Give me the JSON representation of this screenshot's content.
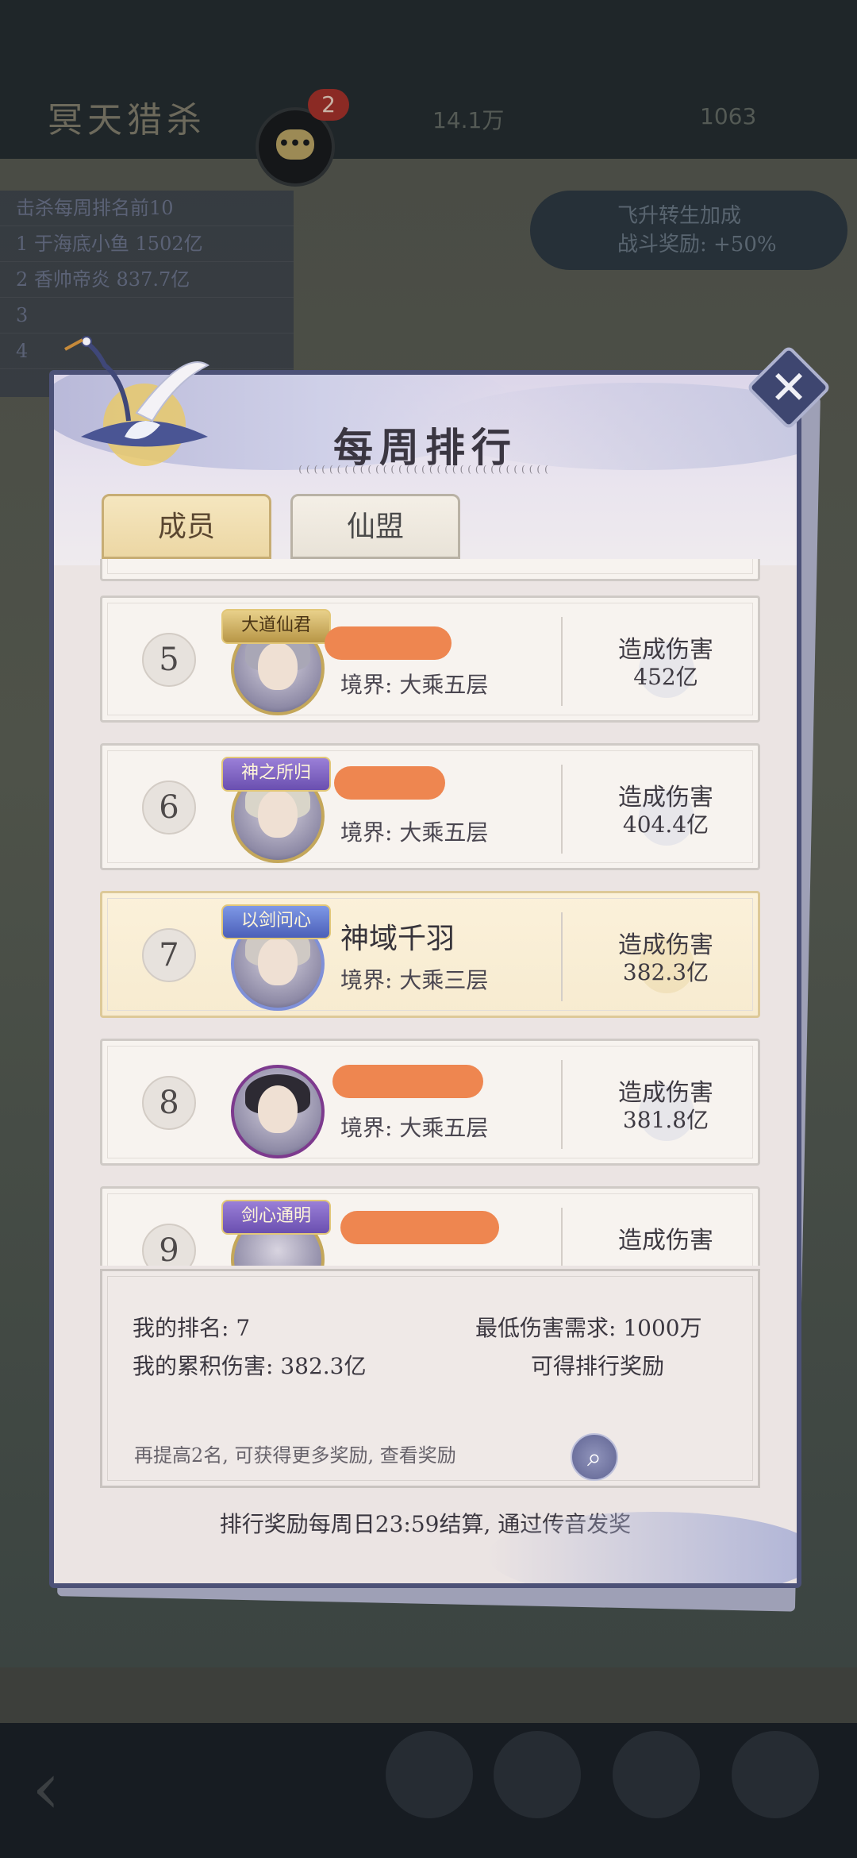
{
  "background": {
    "title": "冥天猎杀",
    "chat_badge": "2",
    "stat_left": "14.1万",
    "stat_right": "1063",
    "right_panel": {
      "line1": "飞升转生加成",
      "line2": "战斗奖励: +50%"
    },
    "left_list_title": "击杀每周排名前10",
    "left_list_items": [
      "1 于海底小鱼 1502亿",
      "2 香帅帝炎 837.7亿",
      "3",
      "4"
    ]
  },
  "dialog": {
    "title": "每周排行",
    "subtitle": "(((((((((((((((((((((((((((((((((",
    "tabs": [
      {
        "label": "成员",
        "active": true
      },
      {
        "label": "仙盟",
        "active": false
      }
    ]
  },
  "rankings": [
    {
      "rank": "5",
      "badge": "大道仙君",
      "name": "",
      "realm": "境界: 大乘五层",
      "damage_label": "造成伤害",
      "damage": "452亿"
    },
    {
      "rank": "6",
      "badge": "神之所归",
      "name": "",
      "realm": "境界: 大乘五层",
      "damage_label": "造成伤害",
      "damage": "404.4亿"
    },
    {
      "rank": "7",
      "badge": "以剑问心",
      "name": "神域千羽",
      "realm": "境界: 大乘三层",
      "damage_label": "造成伤害",
      "damage": "382.3亿"
    },
    {
      "rank": "8",
      "badge": "",
      "name": "",
      "realm": "境界: 大乘五层",
      "damage_label": "造成伤害",
      "damage": "381.8亿"
    },
    {
      "rank": "9",
      "badge": "剑心通明",
      "name": "",
      "realm": "",
      "damage_label": "造成伤害",
      "damage": ""
    }
  ],
  "summary": {
    "my_rank": "我的排名: 7",
    "my_damage": "我的累积伤害: 382.3亿",
    "min_requirement": "最低伤害需求: 1000万",
    "reward_status": "可得排行奖励",
    "hint": "再提高2名, 可获得更多奖励, 查看奖励"
  },
  "footer_note": "排行奖励每周日23:59结算, 通过传音发奖",
  "colors": {
    "accent_gold": "#ecd7a4",
    "frame": "#4c5177",
    "redaction": "#ee8650",
    "self_row": "#f7ebd0"
  },
  "icons": [
    "crane-icon",
    "close-icon",
    "chat-icon",
    "search-icon",
    "back-arrow-icon"
  ]
}
